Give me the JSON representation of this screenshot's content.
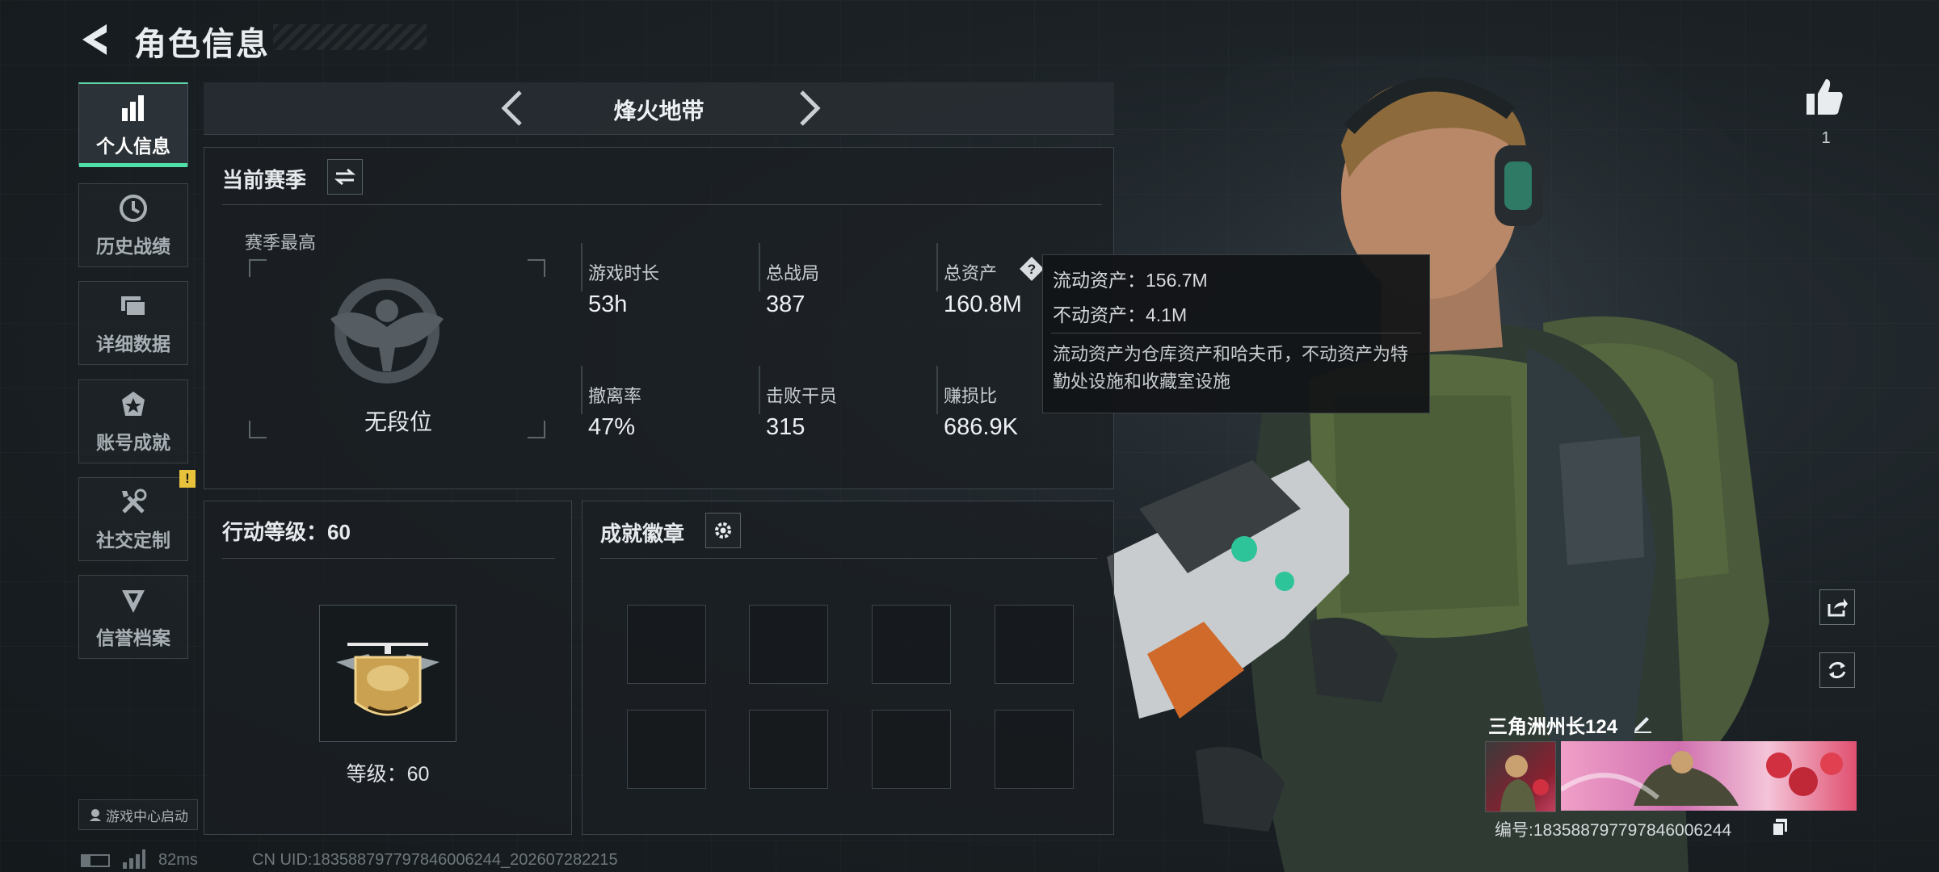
{
  "header": {
    "title": "角色信息"
  },
  "nav": {
    "items": [
      {
        "label": "个人信息",
        "icon": "bar-chart-icon",
        "active": true
      },
      {
        "label": "历史战绩",
        "icon": "history-clock-icon"
      },
      {
        "label": "详细数据",
        "icon": "folder-icon"
      },
      {
        "label": "账号成就",
        "icon": "achievement-icon"
      },
      {
        "label": "社交定制",
        "icon": "tools-icon",
        "badge": "!"
      },
      {
        "label": "信誉档案",
        "icon": "shield-badge-icon"
      }
    ]
  },
  "mode": {
    "title": "烽火地带"
  },
  "season": {
    "title": "当前赛季",
    "best_label": "赛季最高",
    "rank_text": "无段位",
    "stats": [
      {
        "label": "游戏时长",
        "value": "53h"
      },
      {
        "label": "总战局",
        "value": "387"
      },
      {
        "label": "总资产",
        "value": "160.8M"
      },
      {
        "label": "撤离率",
        "value": "47%"
      },
      {
        "label": "击败干员",
        "value": "315"
      },
      {
        "label": "赚损比",
        "value": "686.9K"
      }
    ]
  },
  "tooltip": {
    "line1": "流动资产：156.7M",
    "line2": "不动资产：4.1M",
    "desc": "流动资产为仓库资产和哈夫币，不动资产为特勤处设施和收藏室设施"
  },
  "action_level": {
    "title": "行动等级：60",
    "level_text": "等级：60"
  },
  "badges": {
    "title": "成就徽章"
  },
  "likes": {
    "count": "1"
  },
  "player": {
    "name": "三角洲州长124",
    "id_text": "编号:183588797797846006244"
  },
  "footer": {
    "game_center": "游戏中心启动",
    "ping": "82ms",
    "uid": "CN UID:183588797797846006244_202607282215"
  },
  "colors": {
    "accent": "#4ee0a8",
    "warning": "#e8c23a"
  }
}
